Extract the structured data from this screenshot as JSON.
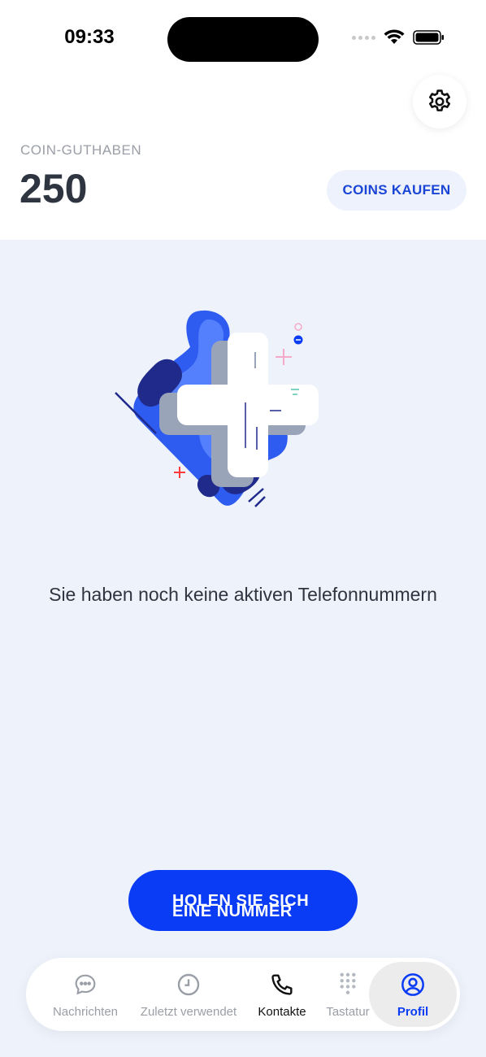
{
  "status_bar": {
    "time": "09:33"
  },
  "balance": {
    "label": "COIN-GUTHABEN",
    "value": "250",
    "buy_label": "COINS KAUFEN"
  },
  "empty_state": {
    "message": "Sie haben noch keine aktiven Telefonnummern",
    "cta_line1": "HOLEN SIE SICH",
    "cta_line2": "EINE NUMMER"
  },
  "tabs": [
    {
      "label": "Nachrichten",
      "icon": "chat-bubble-icon",
      "state": "inactive"
    },
    {
      "label": "Zuletzt verwendet",
      "icon": "clock-icon",
      "state": "inactive"
    },
    {
      "label": "Kontakte",
      "icon": "phone-icon",
      "state": "highlighted"
    },
    {
      "label": "Tastatur",
      "icon": "keypad-icon",
      "state": "inactive"
    },
    {
      "label": "Profil",
      "icon": "profile-icon",
      "state": "selected"
    }
  ],
  "colors": {
    "accent": "#0a3cf5",
    "panel_background": "#eef2fb",
    "buy_button_background": "#eef2fc"
  }
}
